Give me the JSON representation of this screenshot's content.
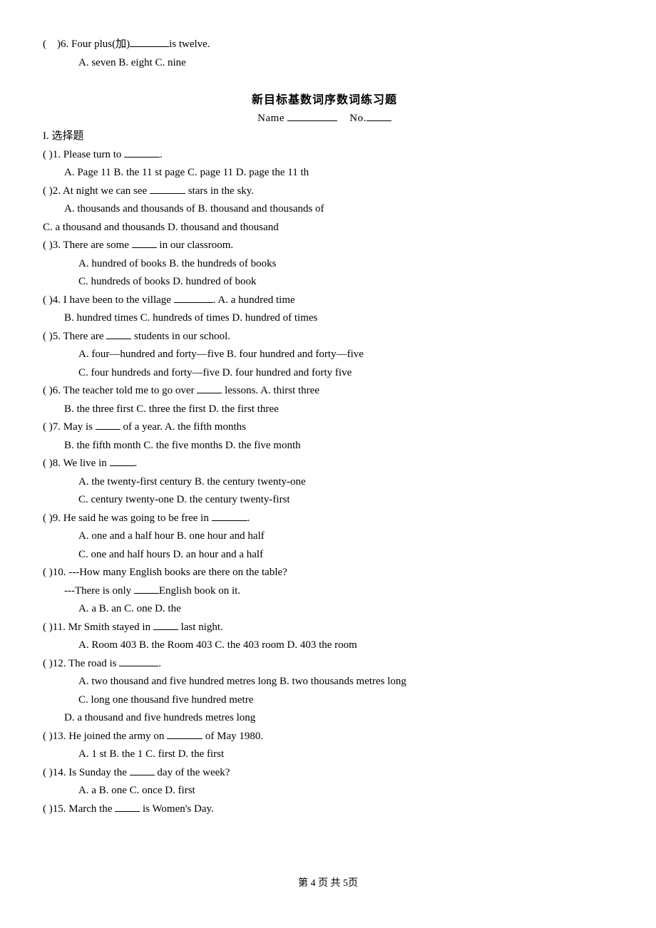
{
  "top": {
    "prefix": "(",
    "suffix": ")6.  Four  plus(加)",
    "tail": "is  twelve.",
    "opts": "A.  seven        B.  eight           C.  nine"
  },
  "title": "新目标基数词序数词练习题",
  "name_label": "Name",
  "no_label": "No.",
  "section": "I. 选择题",
  "q1": {
    "stem": "(  )1. Please turn to ",
    "tail": ".",
    "opts": "A. Page 11   B. the 11 st page   C. page 11   D. page the 11 th"
  },
  "q2": {
    "stem": "(  )2. At night we can see ",
    "tail": " stars in the sky.",
    "opts1": "A. thousands and thousands of     B. thousand and thousands of",
    "opts2": "C. a thousand and thousands     D. thousand and thousand"
  },
  "q3": {
    "stem": "(  )3. There are some ",
    "tail": " in our classroom.",
    "opts1": "A. hundred of books            B. the hundreds of books",
    "opts2": "C. hundreds of books           D. hundred of book"
  },
  "q4": {
    "stem": "(  )4. I have been to the village ",
    "tail": ".        A. a hundred time",
    "opts": "B. hundred times    C. hundreds of times   D. hundred of times"
  },
  "q5": {
    "stem": "(  )5. There are ",
    "tail": " students in our school.",
    "opts1": "A. four—hundred and forty—five      B. four hundred and forty—five",
    "opts2": "C. four hundreds and forty—five      D. four hundred and forty five"
  },
  "q6": {
    "stem": "(  )6. The teacher told me to go over ",
    "tail": " lessons.       A. thirst three",
    "opts": "B. the three first    C. three the first    D. the first three"
  },
  "q7": {
    "stem": "(  )7. May is ",
    "tail": " of a year.               A. the fifth months",
    "opts": "B. the fifth month    C. the five months    D. the five month"
  },
  "q8": {
    "stem": "(  )8. We live in ",
    "tail": ".",
    "opts1": "A. the twenty-first century           B. the century twenty-one",
    "opts2": "C. century twenty-one               D. the century twenty-first"
  },
  "q9": {
    "stem": "(  )9. He said he was going to be free in ",
    "tail": ".",
    "opts1": "A. one and a half hour               B. one hour and half",
    "opts2": "C. one and half hours               D. an hour and a half"
  },
  "q10": {
    "stem": "(  )10. ---How many English books are there on the table?",
    "line2a": "---There is only ",
    "line2b": "English book on it.",
    "opts": "A. a     B. an     C. one     D. the"
  },
  "q11": {
    "stem": "(  )11. Mr Smith stayed in ",
    "tail": " last night.",
    "opts": "A. Room 403   B. the Room 403   C. the 403 room   D. 403 the room"
  },
  "q12": {
    "stem": "(  )12. The road is ",
    "tail": ".",
    "opts1": "A. two thousand and five hundred metres long   B. two thousands metres long",
    "opts2": "C. long one thousand five hundred metre",
    "opts3": "D. a thousand and five hundreds metres long"
  },
  "q13": {
    "stem": "(  )13. He joined the army on ",
    "tail": " of May 1980.",
    "opts": "A. 1 st    B. the 1    C. first    D. the first"
  },
  "q14": {
    "stem": "(  )14.  Is Sunday the ",
    "tail": " day of the week?",
    "opts": "A. a     B. one    C. once     D. first"
  },
  "q15": {
    "stem": "(  )15. March the ",
    "tail": " is Women's Day."
  },
  "footer": "第 4 页 共 5页"
}
